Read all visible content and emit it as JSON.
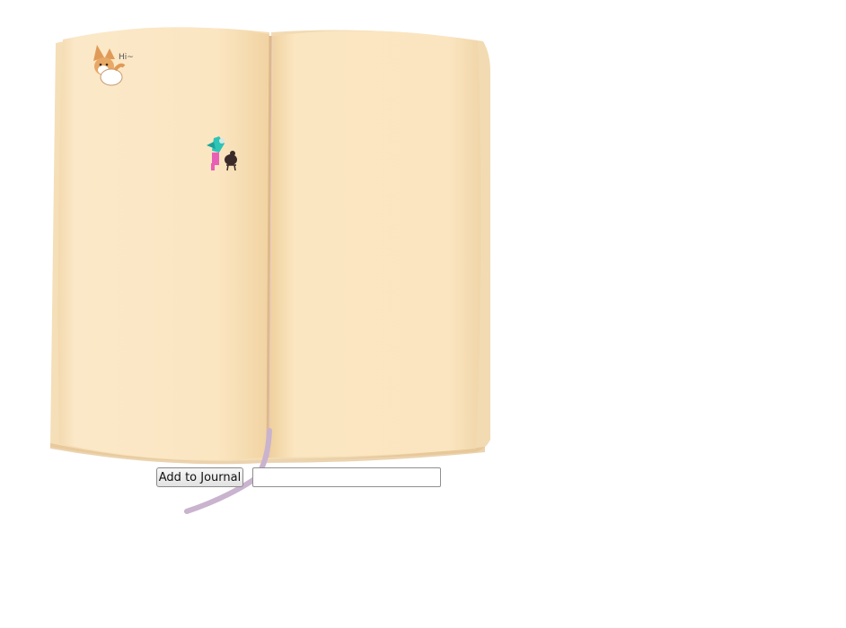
{
  "journal": {
    "add_button_label": "Add to Journal",
    "entry_value": "",
    "entry_placeholder": "",
    "sticker_text": "Hi~"
  },
  "colors": {
    "page": "#fbe7c6",
    "page_shadow": "#ecd0a0",
    "page_edge": "#f3dcb3",
    "spine": "#e6c49b",
    "ribbon": "#c9b3cf",
    "corgi_orange": "#e09a57",
    "bird_teal": "#2ec4b6",
    "person_pink": "#e860b6"
  },
  "icons": {
    "corgi_sticker": "corgi-sticker-icon",
    "bird_sticker": "person-bird-sticker-icon"
  }
}
